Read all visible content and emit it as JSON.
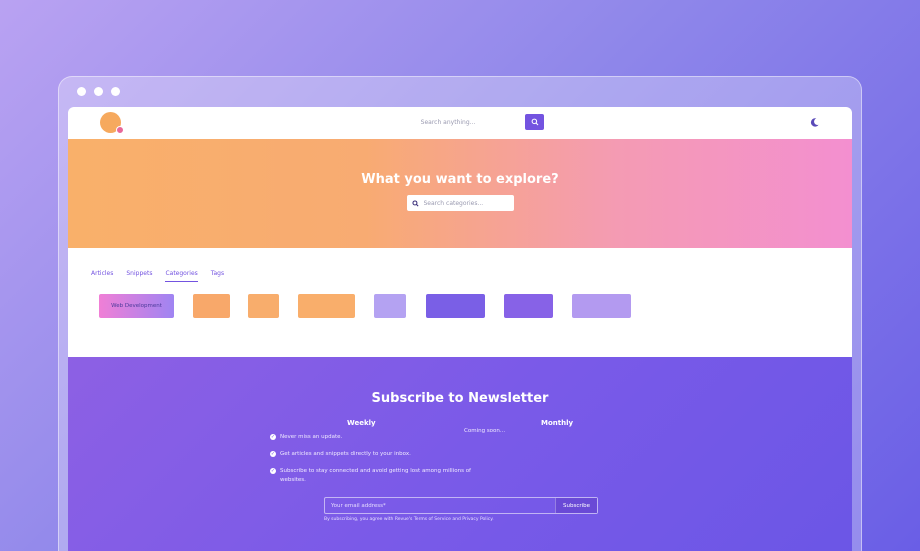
{
  "nav": {
    "search_placeholder": "Search anything..."
  },
  "hero": {
    "title": "What you want to explore?",
    "search_placeholder": "Search categories..."
  },
  "tabs": [
    {
      "label": "Articles"
    },
    {
      "label": "Snippets"
    },
    {
      "label": "Categories",
      "active": true
    },
    {
      "label": "Tags"
    }
  ],
  "categories": [
    {
      "label": "Web Development"
    },
    {
      "label": ""
    },
    {
      "label": ""
    },
    {
      "label": ""
    },
    {
      "label": ""
    },
    {
      "label": ""
    },
    {
      "label": ""
    },
    {
      "label": ""
    }
  ],
  "newsletter": {
    "title": "Subscribe to Newsletter",
    "weekly_title": "Weekly",
    "monthly_title": "Monthly",
    "perks": [
      "Never miss an update.",
      "Get articles and snippets directly to your inbox.",
      "Subscribe to stay connected and avoid getting lost among millions of websites."
    ],
    "monthly_text": "Coming soon...",
    "email_placeholder": "Your email address*",
    "subscribe_label": "Subscribe",
    "legal": "By subscribing, you agree with Revue's Terms of Service and Privacy Policy."
  },
  "colors": {
    "accent": "#7353e0",
    "hero_start": "#f9b06a",
    "hero_end": "#f38fd0",
    "newsletter": "#7a5ae8"
  },
  "icons": [
    "search-icon",
    "moon-icon",
    "check-icon"
  ]
}
